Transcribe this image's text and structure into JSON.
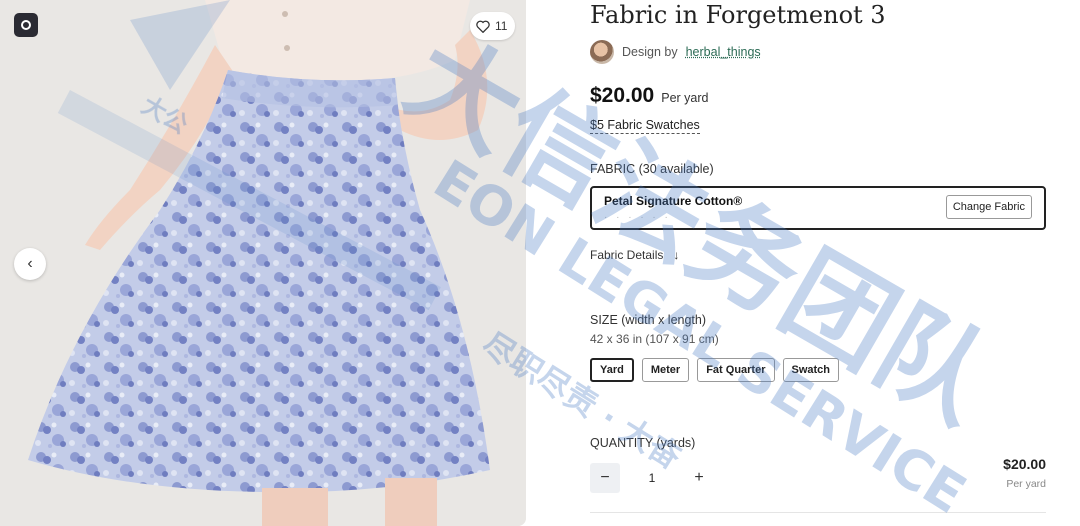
{
  "media": {
    "favorite_count": "11",
    "logo_icon": "spoonflower-logo-icon",
    "prev_icon": "chevron-left-icon"
  },
  "product": {
    "title": "Fabric in Forgetmenot 3",
    "design_by_label": "Design by",
    "designer": "herbal_things",
    "price": "$20.00",
    "price_unit": "Per yard",
    "swatches_link": "$5 Fabric Swatches"
  },
  "fabric": {
    "label": "FABRIC (30 available)",
    "selected_name": "Petal Signature Cotton®",
    "selected_sub": "· · ·  ·  ·  ·",
    "change_label": "Change Fabric",
    "details_label": "Fabric Details",
    "details_icon": "arrow-down-icon"
  },
  "size": {
    "label": "SIZE (width x length)",
    "dimensions": "42 x 36 in (107 x 91 cm)",
    "options": [
      "Yard",
      "Meter",
      "Fat Quarter",
      "Swatch"
    ],
    "selected": "Yard"
  },
  "quantity": {
    "label": "QUANTITY (yards)",
    "value": "1",
    "minus": "−",
    "plus": "+",
    "total": "$20.00",
    "total_unit": "Per yard"
  },
  "watermark": {
    "line1": "大信法务团队",
    "line2": "EON LEGAL SERVICE",
    "line3": "尽职尽责 · 大奋",
    "line4": "大公"
  },
  "colors": {
    "accent_link": "#2c6b55",
    "watermark": "#5a86c5",
    "skirt_base": "#b9c4e2"
  }
}
